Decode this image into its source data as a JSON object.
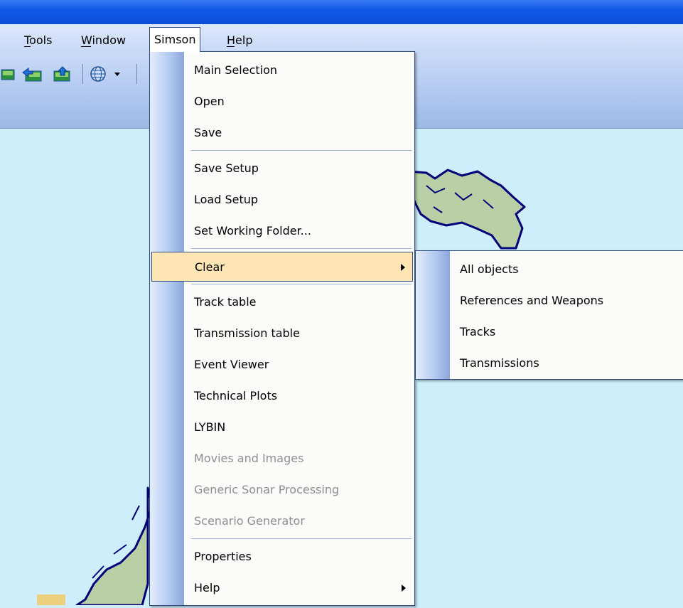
{
  "menubar": {
    "items": [
      {
        "label": "Tools",
        "mnemonic_underlined": "T"
      },
      {
        "label": "Window",
        "mnemonic_underlined": "W"
      },
      {
        "label": "Simson",
        "active": true
      },
      {
        "label": "Help",
        "mnemonic_underlined": "H"
      }
    ]
  },
  "toolbar": {
    "icons": [
      "map-layer-icon",
      "map-back-icon",
      "map-forward-icon",
      "globe-icon",
      "dropdown-arrow-icon"
    ]
  },
  "simson_menu": {
    "items": [
      {
        "label": "Main Selection",
        "enabled": true
      },
      {
        "label": "Open",
        "enabled": true
      },
      {
        "label": "Save",
        "enabled": true
      },
      {
        "label": "Save Setup",
        "enabled": true
      },
      {
        "label": "Load Setup",
        "enabled": true
      },
      {
        "label": "Set Working Folder...",
        "enabled": true
      },
      {
        "label": "Clear",
        "enabled": true,
        "submenu": true,
        "highlighted": true
      },
      {
        "label": "Track table",
        "enabled": true
      },
      {
        "label": "Transmission table",
        "enabled": true
      },
      {
        "label": "Event Viewer",
        "enabled": true
      },
      {
        "label": "Technical Plots",
        "enabled": true
      },
      {
        "label": "LYBIN",
        "enabled": true
      },
      {
        "label": "Movies and Images",
        "enabled": false
      },
      {
        "label": "Generic Sonar Processing",
        "enabled": false
      },
      {
        "label": "Scenario Generator",
        "enabled": false
      },
      {
        "label": "Properties",
        "enabled": true
      },
      {
        "label": "Help",
        "enabled": true,
        "submenu": true
      }
    ]
  },
  "clear_submenu": {
    "items": [
      {
        "label": "All objects"
      },
      {
        "label": "References and Weapons"
      },
      {
        "label": "Tracks"
      },
      {
        "label": "Transmissions"
      }
    ]
  },
  "colors": {
    "titlebar": "#0b4fd6",
    "menu_highlight": "#fde6b4",
    "map_sea": "#cdeefa",
    "coastline": "#00007a",
    "land": "#b9cfa6"
  }
}
